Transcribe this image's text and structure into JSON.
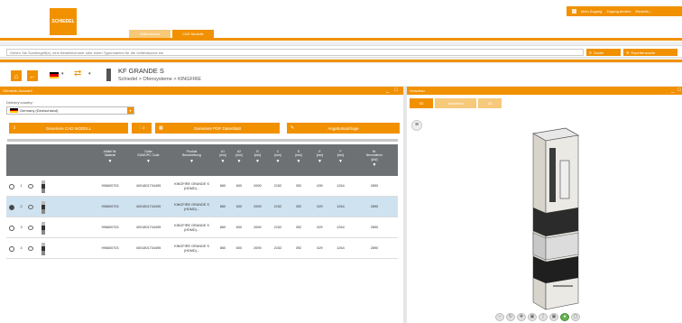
{
  "header": {
    "logo_text": "SCHIEDEL",
    "tabs": [
      {
        "label": "Willkommen",
        "active": false
      },
      {
        "label": "CAD Modelle",
        "active": true
      }
    ],
    "user_menu": [
      "Mein Zugang",
      "Zugang ändern",
      "Einstellu..."
    ]
  },
  "search": {
    "placeholder": "Geben Sie Suchbegriff(e), eine Bestellnummer oder einen Typennamen für die Volltextsuche ein",
    "search_label": "Suche",
    "advanced_label": "Expertensuche"
  },
  "nav": {
    "home_icon": "home-icon",
    "back_icon": "back-arrow-icon",
    "language_flag": "de",
    "product_title": "KF GRANDE S",
    "breadcrumb": [
      "Schiedel",
      "Ofensysteme",
      "KINGFIRE"
    ],
    "breadcrumb_sep": ">"
  },
  "left_panel": {
    "header": "Ofenteile-Auswahl",
    "delivery_label": "Delivery country:",
    "country_value": "Germany (Deutschland)",
    "buttons": {
      "generate_cad": "Generiere CAD MODELL",
      "generate_pdf": "Generiere PDF Datenblatt",
      "request": "Angebotsanfrage"
    },
    "columns": [
      {
        "label": ""
      },
      {
        "label": ""
      },
      {
        "label": ""
      },
      {
        "label": ""
      },
      {
        "label": "Artikel Nr.\nMaterial",
        "filter": true
      },
      {
        "label": "Outer\nEAN/UPC Code",
        "filter": true
      },
      {
        "label": "Produkt\nBeschreibung",
        "filter": true
      },
      {
        "label": "A1\n[mm]",
        "filter": true
      },
      {
        "label": "A2\n[mm]",
        "filter": true
      },
      {
        "label": "B\n[mm]",
        "filter": true
      },
      {
        "label": "C\n[mm]",
        "filter": true
      },
      {
        "label": "D\n[mm]",
        "filter": true
      },
      {
        "label": "E\n[mm]",
        "filter": true
      },
      {
        "label": "F\n[mm]",
        "filter": true
      },
      {
        "label": "Nr.\nNennwärme\n[kW]",
        "filter": true
      }
    ],
    "rows": [
      {
        "num": "1",
        "selected": false,
        "cells": [
          "996600703",
          "4001801734495",
          "KINGFIRE GRANDE S (HDMD)...",
          "860",
          "600",
          "2690",
          "2152",
          "392",
          "639",
          "1264",
          "2890"
        ]
      },
      {
        "num": "2",
        "selected": true,
        "cells": [
          "996600703",
          "4001801734495",
          "KINGFIRE GRANDE S (HDMD)...",
          "860",
          "600",
          "2690",
          "2152",
          "392",
          "629",
          "1264",
          "2890"
        ]
      },
      {
        "num": "3",
        "selected": false,
        "cells": [
          "996600703",
          "4001801734495",
          "KINGFIRE GRANDE S (HDMD)...",
          "860",
          "600",
          "2690",
          "2152",
          "392",
          "629",
          "1264",
          "2890"
        ]
      },
      {
        "num": "4",
        "selected": false,
        "cells": [
          "996600703",
          "4001801734495",
          "KINGFIRE GRANDE S (HDMD)...",
          "860",
          "600",
          "2690",
          "2152",
          "392",
          "629",
          "1264",
          "2890"
        ]
      }
    ]
  },
  "right_panel": {
    "header": "Vorschau",
    "tabs": [
      {
        "label": "3D",
        "active": true
      },
      {
        "label": "Ansichten",
        "active": false
      },
      {
        "label": "2D",
        "active": false
      }
    ],
    "viewer_tools": [
      "zoom-out-icon",
      "rotate-icon",
      "pan-icon",
      "fit-icon",
      "measure-icon",
      "section-icon",
      "color-icon",
      "fullscreen-icon"
    ]
  },
  "colors": {
    "accent": "#f19100",
    "accent_light": "#f7c97a",
    "table_header": "#6e7174",
    "selected_row": "#cfe2ef"
  }
}
